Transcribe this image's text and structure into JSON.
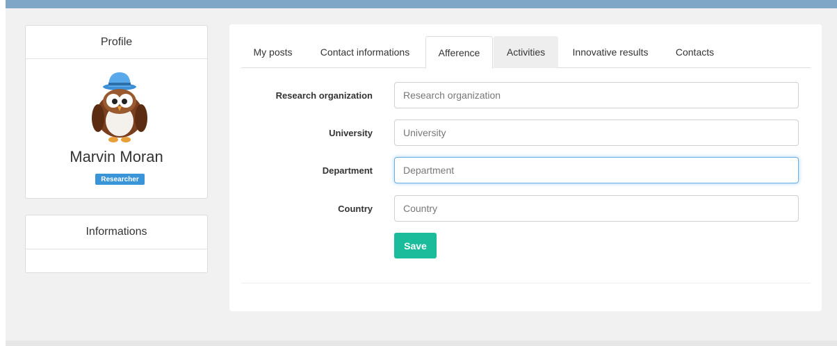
{
  "profile": {
    "heading": "Profile",
    "name": "Marvin Moran",
    "role": "Researcher",
    "avatar_icon": "owl-avatar-icon"
  },
  "informations": {
    "heading": "Informations"
  },
  "tabs": [
    {
      "label": "My posts",
      "state": "normal"
    },
    {
      "label": "Contact informations",
      "state": "normal"
    },
    {
      "label": "Afference",
      "state": "active"
    },
    {
      "label": "Activities",
      "state": "hovered"
    },
    {
      "label": "Innovative results",
      "state": "normal"
    },
    {
      "label": "Contacts",
      "state": "normal"
    }
  ],
  "form": {
    "fields": [
      {
        "label": "Research organization",
        "placeholder": "Research organization",
        "value": ""
      },
      {
        "label": "University",
        "placeholder": "University",
        "value": ""
      },
      {
        "label": "Department",
        "placeholder": "Department",
        "value": "",
        "focused": true
      },
      {
        "label": "Country",
        "placeholder": "Country",
        "value": ""
      }
    ],
    "save_label": "Save"
  },
  "colors": {
    "topbar": "#7fa6c6",
    "badge": "#3a95d8",
    "save_button": "#1abc9c",
    "focus_border": "#66afe9"
  }
}
